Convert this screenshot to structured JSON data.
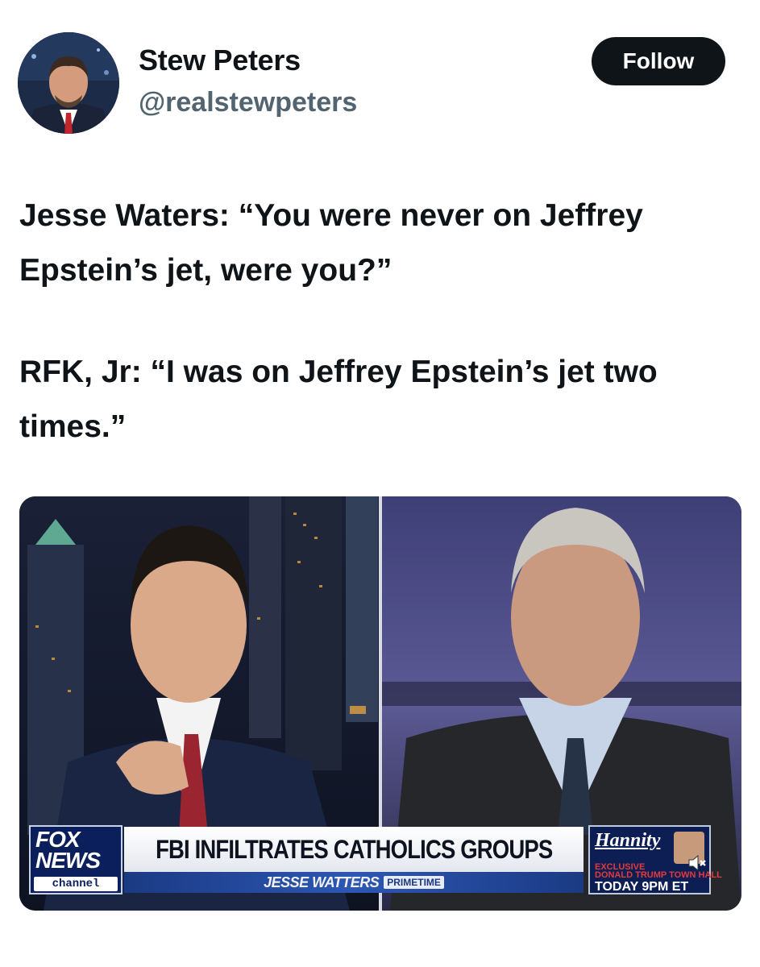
{
  "profile": {
    "name": "Stew Peters",
    "handle": "@realstewpeters",
    "follow_label": "Follow"
  },
  "tweet": {
    "paragraph1": "Jesse Waters: “You were never on Jeffrey Epstein’s jet, were you?”",
    "paragraph2": "RFK, Jr: “I was on Jeffrey Epstein’s jet two times.”"
  },
  "video": {
    "network_logo_top": "FOX",
    "network_logo_bottom": "NEWS",
    "network_logo_channel": "channel",
    "headline": "FBI INFILTRATES CATHOLICS GROUPS",
    "show_name": "JESSE WATTERS",
    "show_tag": "PRIMETIME",
    "promo_title": "Hannity",
    "promo_line1": "EXCLUSIVE",
    "promo_line2": "DONALD TRUMP TOWN HALL",
    "promo_line3": "TODAY 9PM ET",
    "mute_icon": "speaker-muted-icon"
  },
  "colors": {
    "follow_bg": "#0f1419",
    "handle": "#536471",
    "fox_blue": "#0a1f5c"
  }
}
